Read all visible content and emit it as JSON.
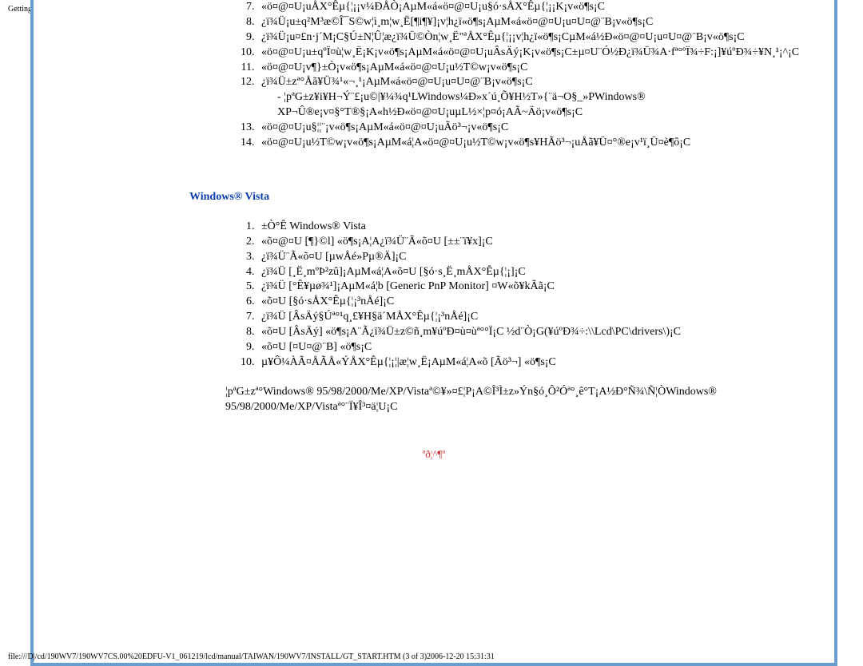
{
  "page_header": "Getting Started",
  "list1": {
    "start": 7,
    "items": [
      "«ö¤@¤U¡uÅX°Êµ{¦¡¡v¼ÐÅÒ¡AµM«á«ö¤@¤U¡u§ó·sÅX°Êµ{¦¡¡K¡v«ö¶s¡C",
      "¿ï¾Ü¡u±q²M³æ©Î¯S©w¦ì¸m¦w¸Ë[¶i¶¥]¡v¦h¿ï«ö¶s¡AµM«á«ö¤@¤U¡u¤U¤@¨B¡v«ö¶s¡C",
      "¿ï¾Ü¡u¤£­n·j´M¡C§Ú±N¦Û¦æ¿ï¾Ü©Ò­n¦w¸Ë\"ªÅX°Êµ{¦¡¡v¦h¿ï«ö¶s¡CµM«á½Ð«ö¤@¤U¡u¤U¤@¨B¡v«ö¶s¡C",
      "«ö¤@¤U¡u±qºÏ¤ù¦w¸Ë¡K¡v«ö¶s¡AµM«á«ö¤@¤U¡uÂsÄý¡K¡v«ö¶s¡C±µ¤U¨Ó½Ð¿ï¾Ü¾A·fª°ºÏ¾÷F:¡]¥úºÐ¾÷¥N¸¹¡^¡C",
      "«ö¤@¤U¡v¶}±Ò¡v«ö¶s¡AµM«á«ö¤@¤U¡u½T©w¡v«ö¶s¡C",
      "¿ï¾Ü±zª°Åã¥Ü¾¹«¬¸¹¡AµM«á«ö¤@¤U¡u¤U¤@¨B¡v«ö¶s¡C",
      "«ö¤@¤U¡u§¦¦¨¡v«ö¶s¡AµM«á«ö¤@¤U¡uÃö³¬¡v«ö¶s¡C",
      "«ö¤@¤U¡u½T©w¡v«ö¶s¡AµM«á¦A«ö¤@¤U¡u½T©w¡v«ö¶s¥HÃö³¬¡uÅã¥Ü¤°®e¡v¹ï¸Ü¤è¶ô¡C"
    ]
  },
  "sub_item_12": "- ¦pªG±z¥i¥H¬Ý¨£¡u©|¥¼¾q¹LWindows¼Ð»x´ú¸Õ¥H½T»{¨ä¬O§_»PWindows® XP¬Û®e¡v¤§°T®§¡A«h½Ð«ö¤@¤U¡uµL½×¦p¤ó¡AÃ~Äö¡v«ö¶s¡C",
  "section_title": "Windows® Vista",
  "vista_list": {
    "items": [
      "±Ò°Ê Windows® Vista",
      "«õ¤@¤U [¶}©l] «ö¶s¡A¦A¿ï¾Ü¨Ã«õ¤U [±±¨ï¥x]¡C",
      "¿ï¾Ü¨Ã«õ¤U [µwÅé»P­µ®Ä]¡C",
      "¿ï¾Ü [¸Ë¸mºÞ²z­û]¡AµM«á¦A«õ¤U [§ó·s¸Ë¸mÅX°Êµ{¦¡]¡C",
      "¿ï¾Ü [°Ê¥µø¾¹]¡AµM«á¦b [Generic PnP Monitor] ¤W«õ¥kÃã¡C",
      "«õ¤U [§ó·sÅX°Êµ{¦¡³nÅé]¡C",
      "¿ï¾Ü [ÂsÄý§Úª°¹q¸£¥H§ä´MÅX°Êµ{¦¡³nÅé]¡C",
      "«õ¤U [ÂsÄý] «ö¶s¡A¨Ã¿ï¾Ü±z©ñ¸m¥úºÐ¤ù¤ùª°°Ï¡C ½d¨Ò¡G(¥úºÐ¾÷:\\\\Lcd\\PC\\drivers\\)¡C",
      "«õ¤U [¤U¤@¨B] «ö¶s¡C",
      "µ¥­Ô¼ÀÃ¤ÅÃÅ«ÝÅX°Êµ{¦¡¦|æ¦w¸Ë¡AµM«á¦A«õ [Ãö³¬] «ö¶s¡C"
    ]
  },
  "para1": "¦pªG±zª°Windows® 95/98/2000/Me/XP/Vistaª©¥»¤£¦P¡A©Î³Ì±z»Ý­n§ó¸Ô²Óª°¸ê°T¡A½Ð°Ñ¾\\Ñ¦ÒWindows® 95/98/2000/Me/XP/Vistaª°¨Ï¥Î³¤ä¦U¡C",
  "center_link_label": "ªð¦^­¶­º",
  "footer_path": "file:///D|/cd/190WV7/190WV7CS.00%20EDFU-V1_061219/lcd/manual/TAIWAN/190WV7/INSTALL/GT_START.HTM (3 of 3)2006-12-20 15:31:31"
}
